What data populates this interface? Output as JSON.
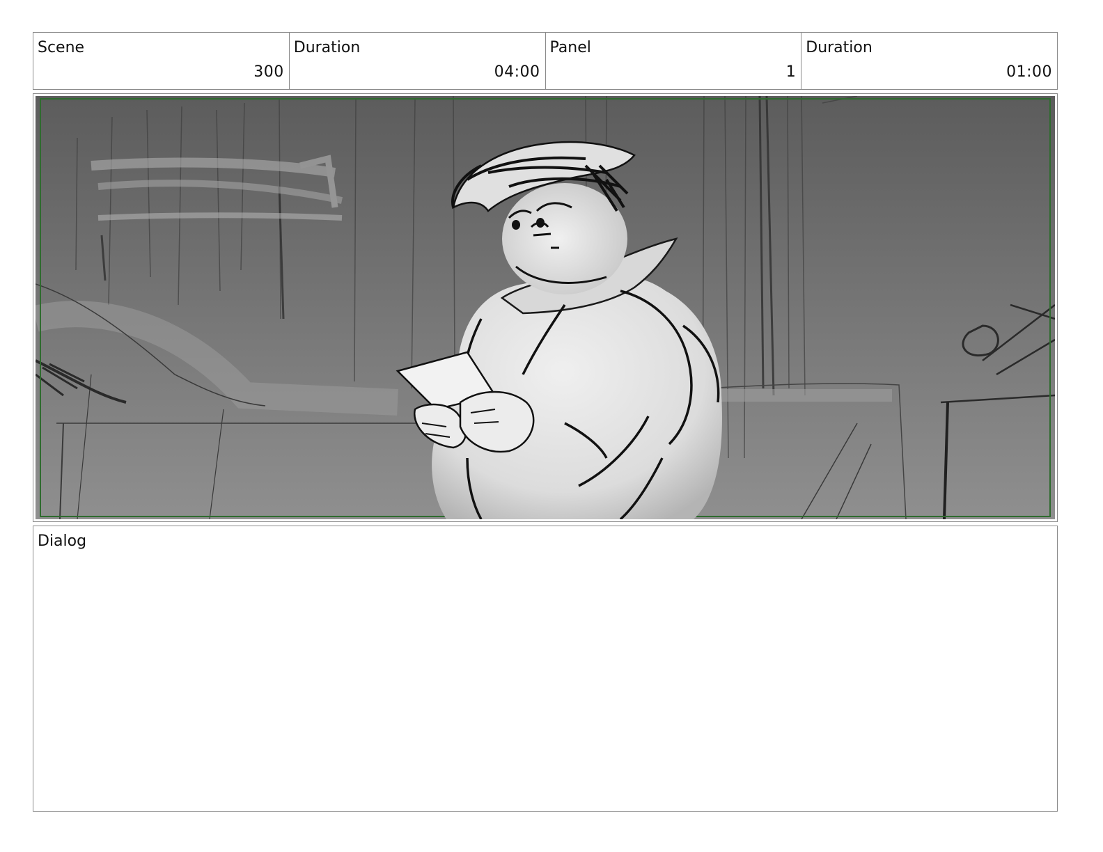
{
  "header": {
    "scene_label": "Scene",
    "scene_value": "300",
    "scene_duration_label": "Duration",
    "scene_duration_value": "04:00",
    "panel_label": "Panel",
    "panel_value": "1",
    "panel_duration_label": "Duration",
    "panel_duration_value": "01:00"
  },
  "panel": {
    "safe_frame_color": "#2e6b2e",
    "background_top_color": "#5c5c5c",
    "background_bottom_color": "#8f8f8f"
  },
  "dialog": {
    "label": "Dialog",
    "text": ""
  }
}
